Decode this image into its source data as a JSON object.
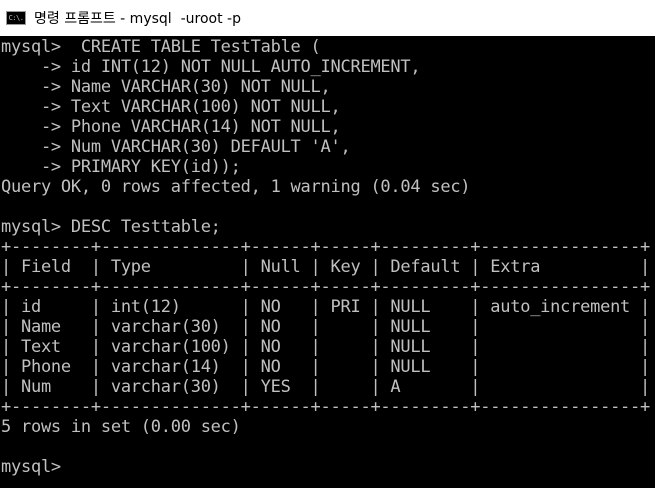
{
  "window": {
    "title": "명령 프롬프트 - mysql  -uroot -p",
    "icon": "cmd-console-icon",
    "icon_text": "C:\\."
  },
  "console": {
    "lines": [
      "mysql>  CREATE TABLE TestTable (",
      "    -> id INT(12) NOT NULL AUTO_INCREMENT,",
      "    -> Name VARCHAR(30) NOT NULL,",
      "    -> Text VARCHAR(100) NOT NULL,",
      "    -> Phone VARCHAR(14) NOT NULL,",
      "    -> Num VARCHAR(30) DEFAULT 'A',",
      "    -> PRIMARY KEY(id));",
      "Query OK, 0 rows affected, 1 warning (0.04 sec)",
      "",
      "mysql> DESC Testtable;",
      "+--------+--------------+------+-----+---------+----------------+",
      "| Field  | Type         | Null | Key | Default | Extra          |",
      "+--------+--------------+------+-----+---------+----------------+",
      "| id     | int(12)      | NO   | PRI | NULL    | auto_increment |",
      "| Name   | varchar(30)  | NO   |     | NULL    |                |",
      "| Text   | varchar(100) | NO   |     | NULL    |                |",
      "| Phone  | varchar(14)  | NO   |     | NULL    |                |",
      "| Num    | varchar(30)  | YES  |     | A       |                |",
      "+--------+--------------+------+-----+---------+----------------+",
      "5 rows in set (0.00 sec)",
      "",
      "mysql>"
    ]
  },
  "colors": {
    "background": "#000000",
    "foreground": "#c0c0c0",
    "titlebar": "#ffffff"
  }
}
